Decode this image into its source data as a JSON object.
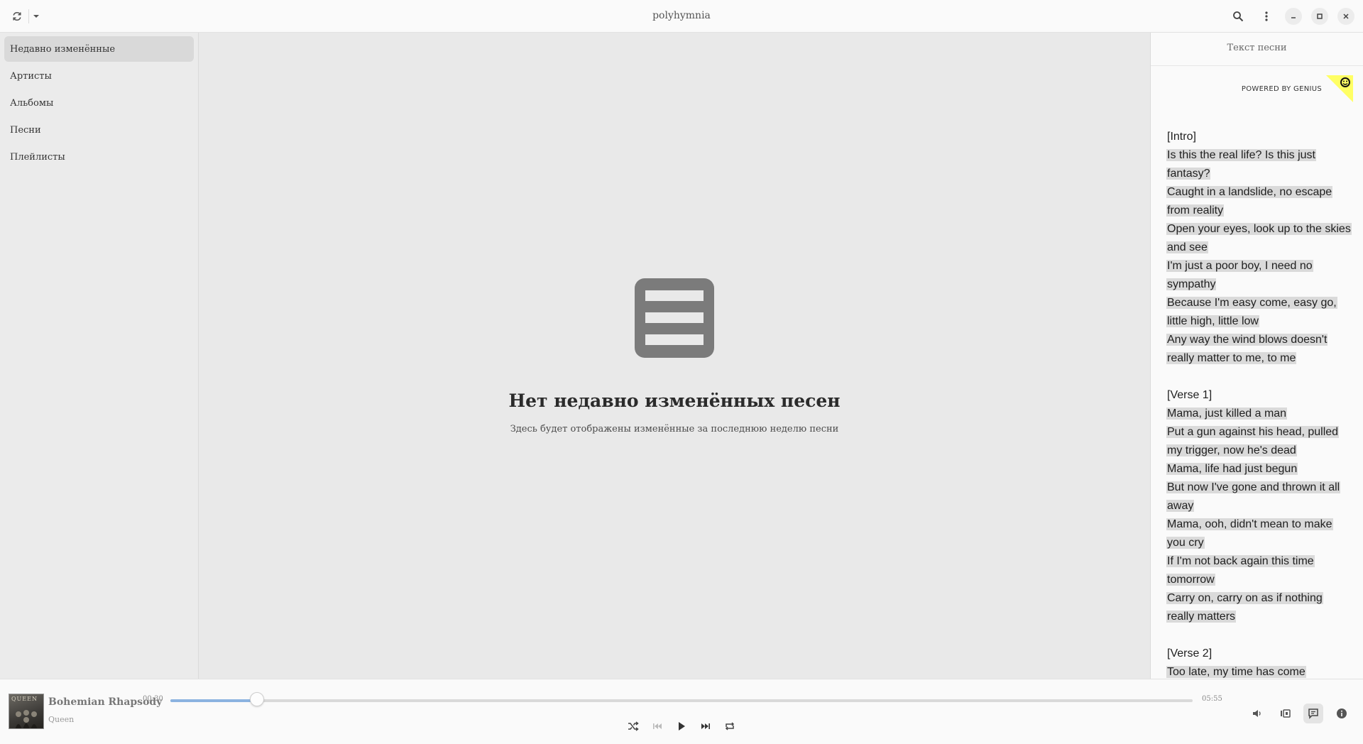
{
  "app": {
    "title": "polyhymnia"
  },
  "header": {
    "refresh_icon": "refresh-icon",
    "dropdown_icon": "chevron-down-icon",
    "search_icon": "search-icon",
    "menu_icon": "kebab-menu-icon",
    "window_controls": [
      "minimize-icon",
      "maximize-icon",
      "close-icon"
    ]
  },
  "sidebar": {
    "items": [
      {
        "label": "Недавно изменённые",
        "active": true
      },
      {
        "label": "Артисты",
        "active": false
      },
      {
        "label": "Альбомы",
        "active": false
      },
      {
        "label": "Песни",
        "active": false
      },
      {
        "label": "Плейлисты",
        "active": false
      }
    ]
  },
  "main": {
    "empty_icon": "list-icon",
    "empty_title": "Нет недавно изменённых песен",
    "empty_subtitle": "Здесь будет отображены изменённые за последнюю неделю песни"
  },
  "lyrics": {
    "title": "Текст песни",
    "powered_by": "POWERED BY GENIUS",
    "lines": [
      "[Intro]",
      "Is this the real life? Is this just fantasy?",
      "Caught in a landslide, no escape from reality",
      "Open your eyes, look up to the skies and see",
      "I'm just a poor boy, I need no sympathy",
      "Because I'm easy come, easy go, little high, little low",
      "Any way the wind blows doesn't really matter to me, to me",
      "",
      "[Verse 1]",
      "Mama, just killed a man",
      "Put a gun against his head, pulled my trigger, now he's dead",
      "Mama, life had just begun",
      "But now I've gone and thrown it all away",
      "Mama, ooh, didn't mean to make you cry",
      "If I'm not back again this time tomorrow",
      "Carry on, carry on as if nothing really matters",
      "",
      "[Verse 2]",
      "Too late, my time has come"
    ]
  },
  "player": {
    "cover_text": "QUEEN",
    "song_title": "Bohemian Rhapsody",
    "artist": "Queen",
    "elapsed": "00:30",
    "duration": "05:55",
    "progress": 0.0845,
    "controls": [
      "shuffle-icon",
      "previous-icon",
      "play-icon",
      "next-icon",
      "repeat-icon"
    ],
    "right_buttons": [
      "volume-icon",
      "queue-icon",
      "lyrics-icon",
      "info-icon"
    ],
    "accent_color": "#8bb3e0"
  }
}
